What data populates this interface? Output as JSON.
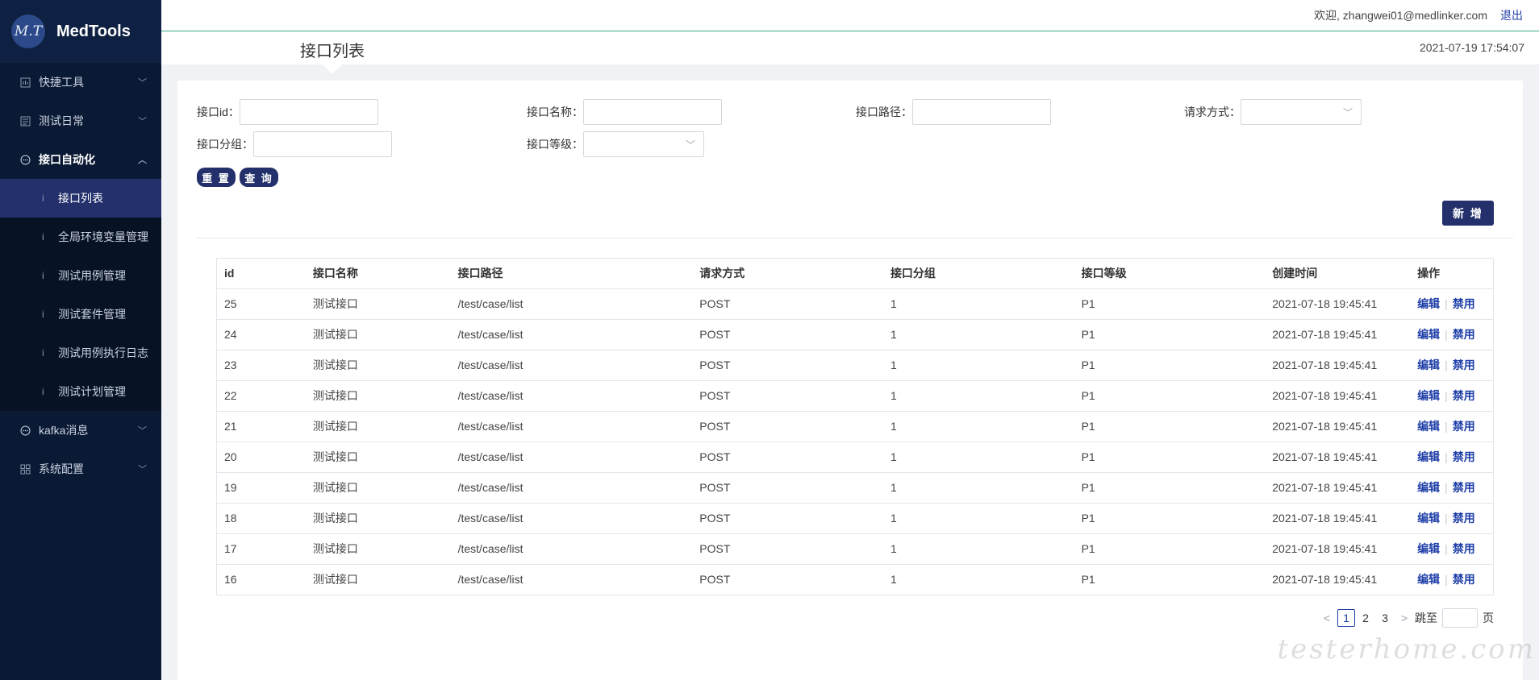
{
  "brand": {
    "logo": "M.T",
    "name": "MedTools"
  },
  "sidebar": {
    "items": [
      {
        "label": "快捷工具",
        "icon": "tools-icon",
        "chevron": "chevron-down-icon"
      },
      {
        "label": "测试日常",
        "icon": "calendar-icon",
        "chevron": "chevron-down-icon"
      },
      {
        "label": "接口自动化",
        "icon": "chat-icon",
        "chevron": "chevron-up-icon"
      }
    ],
    "subitems": [
      {
        "label": "接口列表",
        "active": true
      },
      {
        "label": "全局环境变量管理"
      },
      {
        "label": "测试用例管理"
      },
      {
        "label": "测试套件管理"
      },
      {
        "label": "测试用例执行日志"
      },
      {
        "label": "测试计划管理"
      }
    ],
    "items_after": [
      {
        "label": "kafka消息",
        "icon": "chat-icon"
      },
      {
        "label": "系统配置",
        "icon": "grid-icon"
      }
    ],
    "sub_dot": "i"
  },
  "header": {
    "welcome": "欢迎, zhangwei01@medlinker.com",
    "logout": "退出"
  },
  "titlebar": {
    "title": "接口列表",
    "datetime": "2021-07-19 17:54:07"
  },
  "filters": {
    "id_label": "接口id：",
    "name_label": "接口名称：",
    "path_label": "接口路径：",
    "method_label": "请求方式：",
    "group_label": "接口分组：",
    "level_label": "接口等级："
  },
  "buttons": {
    "reset": "重 置",
    "query": "查 询",
    "add": "新 增"
  },
  "table": {
    "headers": [
      "id",
      "接口名称",
      "接口路径",
      "请求方式",
      "接口分组",
      "接口等级",
      "创建时间",
      "操作"
    ],
    "edit": "编辑",
    "disable": "禁用",
    "rows": [
      [
        "25",
        "测试接口",
        "/test/case/list",
        "POST",
        "1",
        "P1",
        "2021-07-18 19:45:41"
      ],
      [
        "24",
        "测试接口",
        "/test/case/list",
        "POST",
        "1",
        "P1",
        "2021-07-18 19:45:41"
      ],
      [
        "23",
        "测试接口",
        "/test/case/list",
        "POST",
        "1",
        "P1",
        "2021-07-18 19:45:41"
      ],
      [
        "22",
        "测试接口",
        "/test/case/list",
        "POST",
        "1",
        "P1",
        "2021-07-18 19:45:41"
      ],
      [
        "21",
        "测试接口",
        "/test/case/list",
        "POST",
        "1",
        "P1",
        "2021-07-18 19:45:41"
      ],
      [
        "20",
        "测试接口",
        "/test/case/list",
        "POST",
        "1",
        "P1",
        "2021-07-18 19:45:41"
      ],
      [
        "19",
        "测试接口",
        "/test/case/list",
        "POST",
        "1",
        "P1",
        "2021-07-18 19:45:41"
      ],
      [
        "18",
        "测试接口",
        "/test/case/list",
        "POST",
        "1",
        "P1",
        "2021-07-18 19:45:41"
      ],
      [
        "17",
        "测试接口",
        "/test/case/list",
        "POST",
        "1",
        "P1",
        "2021-07-18 19:45:41"
      ],
      [
        "16",
        "测试接口",
        "/test/case/list",
        "POST",
        "1",
        "P1",
        "2021-07-18 19:45:41"
      ]
    ]
  },
  "pagination": {
    "prev": "<",
    "pages": [
      "1",
      "2",
      "3"
    ],
    "next": ">",
    "jump_prefix": "跳至",
    "jump_suffix": "页",
    "current": "1"
  },
  "watermark": "testerhome.com"
}
